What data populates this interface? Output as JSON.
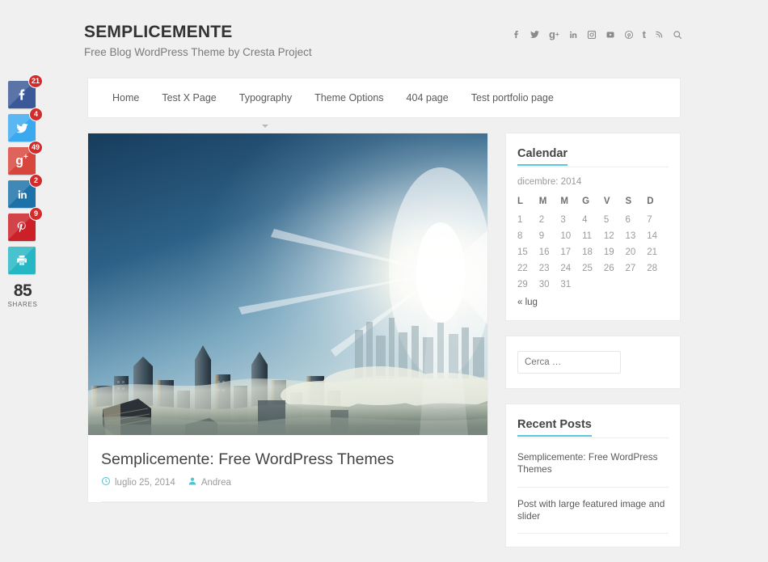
{
  "colors": {
    "accent": "#5bc8dc",
    "page_bg": "#f0f0f0",
    "card_bg": "#ffffff",
    "badge_red": "#d32b2b",
    "facebook": "#3b5998",
    "twitter": "#3aa9f0",
    "googleplus": "#d8453c",
    "linkedin": "#1c72a8",
    "pinterest": "#cb2027",
    "print": "#25b7c4"
  },
  "share_bar": {
    "buttons": [
      {
        "name": "facebook",
        "icon": "facebook-icon",
        "count": "21",
        "color": "#3b5998"
      },
      {
        "name": "twitter",
        "icon": "twitter-icon",
        "count": "4",
        "color": "#3aa9f0"
      },
      {
        "name": "googleplus",
        "icon": "google-plus-icon",
        "count": "49",
        "color": "#d8453c"
      },
      {
        "name": "linkedin",
        "icon": "linkedin-icon",
        "count": "2",
        "color": "#1c72a8"
      },
      {
        "name": "pinterest",
        "icon": "pinterest-icon",
        "count": "9",
        "color": "#cb2027"
      },
      {
        "name": "print",
        "icon": "print-icon",
        "count": "",
        "color": "#25b7c4"
      }
    ],
    "total": "85",
    "total_label": "SHARES"
  },
  "header": {
    "title": "SEMPLICEMENTE",
    "tagline": "Free Blog WordPress Theme by Cresta Project",
    "social": [
      {
        "icon": "facebook-icon",
        "label": "Facebook"
      },
      {
        "icon": "twitter-icon",
        "label": "Twitter"
      },
      {
        "icon": "google-plus-icon",
        "label": "Google Plus"
      },
      {
        "icon": "linkedin-icon",
        "label": "LinkedIn"
      },
      {
        "icon": "instagram-icon",
        "label": "Instagram"
      },
      {
        "icon": "youtube-icon",
        "label": "YouTube"
      },
      {
        "icon": "pinterest-icon",
        "label": "Pinterest"
      },
      {
        "icon": "tumblr-icon",
        "label": "Tumblr"
      },
      {
        "icon": "rss-icon",
        "label": "RSS"
      },
      {
        "icon": "search-icon",
        "label": "Search"
      }
    ]
  },
  "nav": {
    "items": [
      {
        "label": "Home",
        "has_dropdown": false
      },
      {
        "label": "Test X Page",
        "has_dropdown": false
      },
      {
        "label": "Typography",
        "has_dropdown": true
      },
      {
        "label": "Theme Options",
        "has_dropdown": false
      },
      {
        "label": "404 page",
        "has_dropdown": false
      },
      {
        "label": "Test portfolio page",
        "has_dropdown": false
      }
    ]
  },
  "post": {
    "featured_image_alt": "City skyscrapers above fog at sunrise",
    "title": "Semplicemente: Free WordPress Themes",
    "date": "luglio 25, 2014",
    "author": "Andrea"
  },
  "sidebar": {
    "calendar": {
      "title": "Calendar",
      "caption": "dicembre: 2014",
      "day_headers": [
        "L",
        "M",
        "M",
        "G",
        "V",
        "S",
        "D"
      ],
      "weeks": [
        [
          "1",
          "2",
          "3",
          "4",
          "5",
          "6",
          "7"
        ],
        [
          "8",
          "9",
          "10",
          "11",
          "12",
          "13",
          "14"
        ],
        [
          "15",
          "16",
          "17",
          "18",
          "19",
          "20",
          "21"
        ],
        [
          "22",
          "23",
          "24",
          "25",
          "26",
          "27",
          "28"
        ],
        [
          "29",
          "30",
          "31",
          "",
          "",
          "",
          ""
        ]
      ],
      "prev_link": "« lug"
    },
    "search": {
      "placeholder": "Cerca …",
      "value": ""
    },
    "recent_posts": {
      "title": "Recent Posts",
      "items": [
        "Semplicemente: Free WordPress Themes",
        "Post with large featured image and slider"
      ]
    }
  }
}
